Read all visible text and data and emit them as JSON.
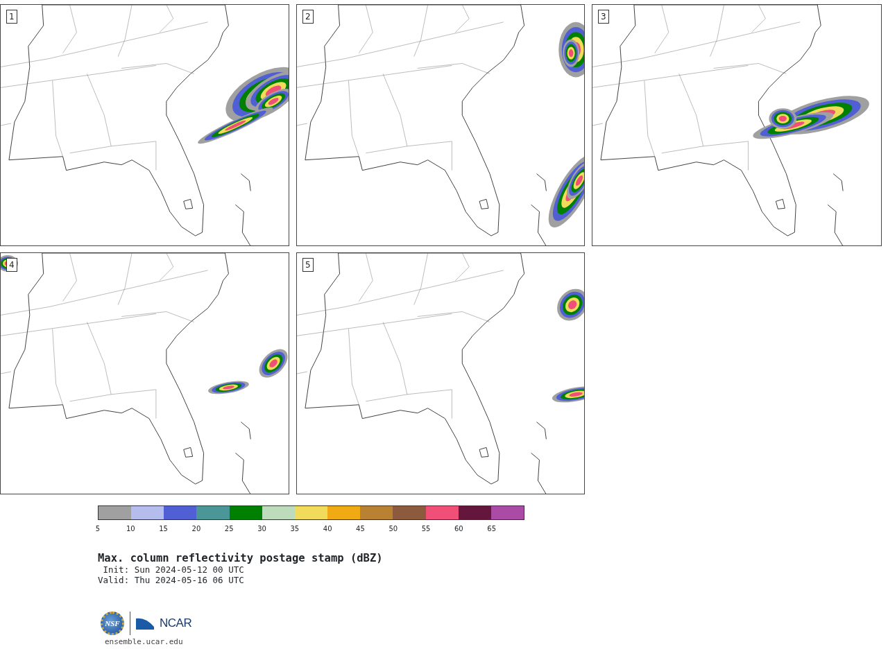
{
  "panels": [
    {
      "label": "1"
    },
    {
      "label": "2"
    },
    {
      "label": "3"
    },
    {
      "label": "4"
    },
    {
      "label": "5"
    }
  ],
  "colorbar": {
    "segments": [
      {
        "color": "#a0a0a0"
      },
      {
        "color": "#b4bdec"
      },
      {
        "color": "#5060d4"
      },
      {
        "color": "#4b9696"
      },
      {
        "color": "#008000"
      },
      {
        "color": "#bcdcbc"
      },
      {
        "color": "#f0dc5a"
      },
      {
        "color": "#f0aa14"
      },
      {
        "color": "#b98232"
      },
      {
        "color": "#8c5a3c"
      },
      {
        "color": "#f05078"
      },
      {
        "color": "#64163c"
      },
      {
        "color": "#aa4ba5"
      }
    ],
    "ticks": [
      "5",
      "10",
      "15",
      "20",
      "25",
      "30",
      "35",
      "40",
      "45",
      "50",
      "55",
      "60",
      "65"
    ]
  },
  "title": "Max. column reflectivity postage stamp (dBZ)",
  "init": " Init: Sun 2024-05-12 00 UTC",
  "valid": "Valid: Thu 2024-05-16 06 UTC",
  "logos": {
    "left": "NSF",
    "right": "NCAR"
  },
  "url": "ensemble.ucar.edu"
}
